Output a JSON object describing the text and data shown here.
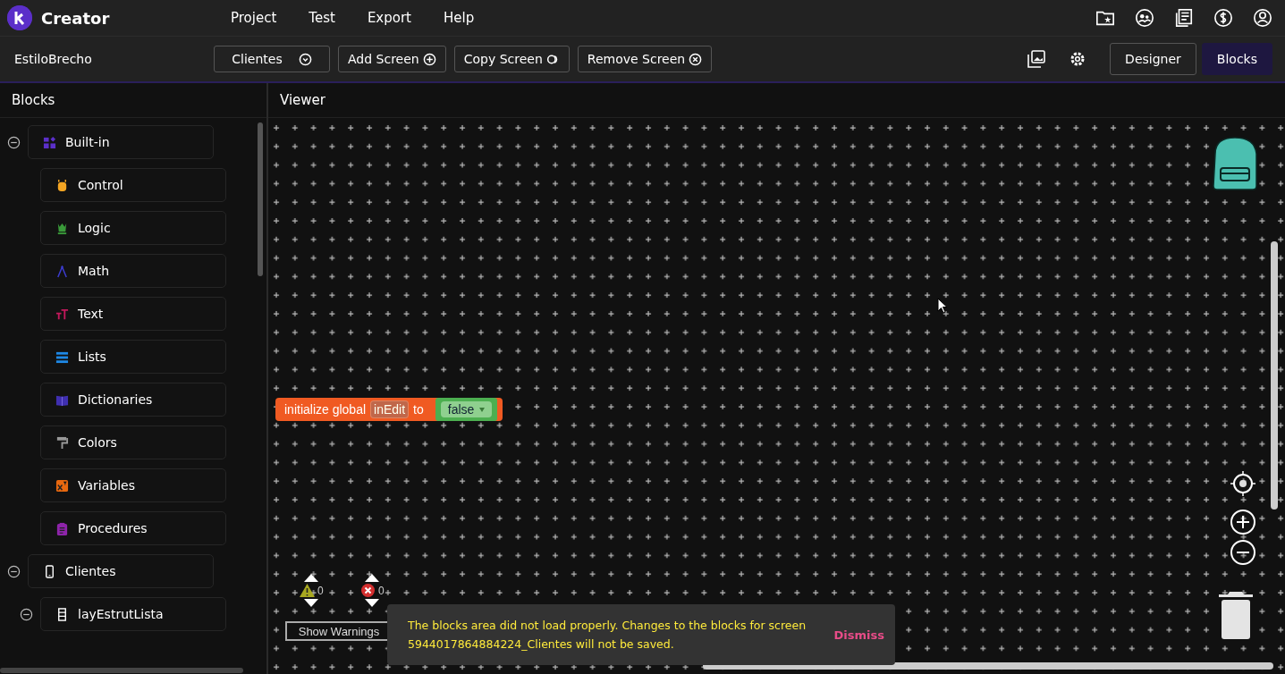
{
  "app": {
    "name": "Creator"
  },
  "menu": [
    "Project",
    "Test",
    "Export",
    "Help"
  ],
  "toolbar": {
    "project": "EstiloBrecho",
    "screen_select": "Clientes",
    "buttons": [
      {
        "label": "Add Screen",
        "kind": "add"
      },
      {
        "label": "Copy Screen",
        "kind": "copy"
      },
      {
        "label": "Remove Screen",
        "kind": "remove"
      }
    ],
    "view_tabs": [
      {
        "label": "Designer",
        "selected": false
      },
      {
        "label": "Blocks",
        "selected": true
      }
    ]
  },
  "sidebar": {
    "title": "Blocks",
    "tree": [
      {
        "label": "Built-in",
        "kind": "builtin",
        "expanded": true,
        "children": [
          {
            "label": "Control",
            "kind": "control"
          },
          {
            "label": "Logic",
            "kind": "logic"
          },
          {
            "label": "Math",
            "kind": "math"
          },
          {
            "label": "Text",
            "kind": "text"
          },
          {
            "label": "Lists",
            "kind": "lists"
          },
          {
            "label": "Dictionaries",
            "kind": "dictionaries"
          },
          {
            "label": "Colors",
            "kind": "colors"
          },
          {
            "label": "Variables",
            "kind": "variables"
          },
          {
            "label": "Procedures",
            "kind": "procedures"
          }
        ]
      },
      {
        "label": "Clientes",
        "kind": "screen",
        "expanded": true,
        "children": [
          {
            "label": "layEstrutLista",
            "kind": "layout",
            "expanded": true
          }
        ]
      }
    ]
  },
  "viewer": {
    "title": "Viewer",
    "block": {
      "parts": [
        "initialize global",
        "inEdit",
        "to",
        "false"
      ]
    },
    "warnings": {
      "warning_count": "0",
      "error_count": "0",
      "toggle": "Show Warnings"
    },
    "toast": {
      "message": "The blocks area did not load properly. Changes to the blocks for screen 5944017864884224_Clientes will not be saved.",
      "action": "Dismiss"
    }
  }
}
